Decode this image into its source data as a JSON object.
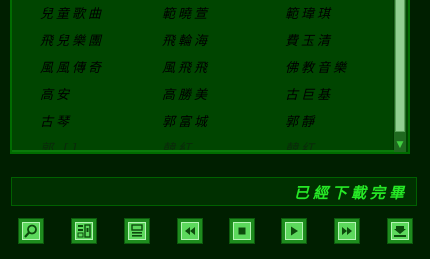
{
  "song_list": {
    "rows": [
      [
        "兒童歌曲",
        "範曉萱",
        "範瑋琪"
      ],
      [
        "飛兒樂團",
        "飛輪海",
        "費玉清"
      ],
      [
        "風風傳奇",
        "風飛飛",
        "佛教音樂"
      ],
      [
        "高安",
        "高勝美",
        "古巨基"
      ],
      [
        "古琴",
        "郭富城",
        "郭靜"
      ],
      [
        "郭 []",
        "韓紅",
        "韓红"
      ]
    ]
  },
  "status": {
    "text": "已經下載完畢"
  },
  "toolbar": {
    "buttons": [
      {
        "icon": "magnifier-icon"
      },
      {
        "icon": "lyrics-icon"
      },
      {
        "icon": "playlist-icon"
      },
      {
        "icon": "rewind-icon"
      },
      {
        "icon": "stop-icon"
      },
      {
        "icon": "play-icon"
      },
      {
        "icon": "fast-forward-icon"
      },
      {
        "icon": "download-icon"
      }
    ]
  },
  "colors": {
    "background": "#001f00",
    "list_bg": "#004500",
    "status_text": "#26e826",
    "button_bg": "#5cd85c"
  }
}
